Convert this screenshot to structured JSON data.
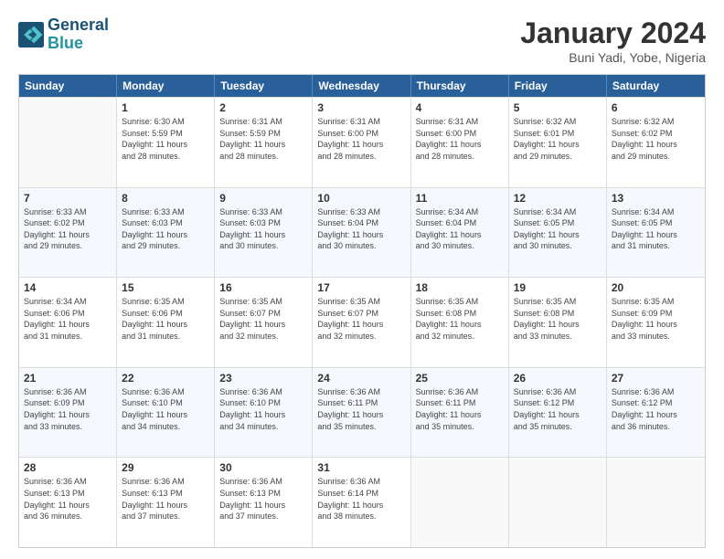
{
  "header": {
    "logo_line1": "General",
    "logo_line2": "Blue",
    "title": "January 2024",
    "subtitle": "Buni Yadi, Yobe, Nigeria"
  },
  "days_of_week": [
    "Sunday",
    "Monday",
    "Tuesday",
    "Wednesday",
    "Thursday",
    "Friday",
    "Saturday"
  ],
  "weeks": [
    [
      {
        "day": "",
        "info": ""
      },
      {
        "day": "1",
        "info": "Sunrise: 6:30 AM\nSunset: 5:59 PM\nDaylight: 11 hours\nand 28 minutes."
      },
      {
        "day": "2",
        "info": "Sunrise: 6:31 AM\nSunset: 5:59 PM\nDaylight: 11 hours\nand 28 minutes."
      },
      {
        "day": "3",
        "info": "Sunrise: 6:31 AM\nSunset: 6:00 PM\nDaylight: 11 hours\nand 28 minutes."
      },
      {
        "day": "4",
        "info": "Sunrise: 6:31 AM\nSunset: 6:00 PM\nDaylight: 11 hours\nand 28 minutes."
      },
      {
        "day": "5",
        "info": "Sunrise: 6:32 AM\nSunset: 6:01 PM\nDaylight: 11 hours\nand 29 minutes."
      },
      {
        "day": "6",
        "info": "Sunrise: 6:32 AM\nSunset: 6:02 PM\nDaylight: 11 hours\nand 29 minutes."
      }
    ],
    [
      {
        "day": "7",
        "info": "Sunrise: 6:33 AM\nSunset: 6:02 PM\nDaylight: 11 hours\nand 29 minutes."
      },
      {
        "day": "8",
        "info": "Sunrise: 6:33 AM\nSunset: 6:03 PM\nDaylight: 11 hours\nand 29 minutes."
      },
      {
        "day": "9",
        "info": "Sunrise: 6:33 AM\nSunset: 6:03 PM\nDaylight: 11 hours\nand 30 minutes."
      },
      {
        "day": "10",
        "info": "Sunrise: 6:33 AM\nSunset: 6:04 PM\nDaylight: 11 hours\nand 30 minutes."
      },
      {
        "day": "11",
        "info": "Sunrise: 6:34 AM\nSunset: 6:04 PM\nDaylight: 11 hours\nand 30 minutes."
      },
      {
        "day": "12",
        "info": "Sunrise: 6:34 AM\nSunset: 6:05 PM\nDaylight: 11 hours\nand 30 minutes."
      },
      {
        "day": "13",
        "info": "Sunrise: 6:34 AM\nSunset: 6:05 PM\nDaylight: 11 hours\nand 31 minutes."
      }
    ],
    [
      {
        "day": "14",
        "info": "Sunrise: 6:34 AM\nSunset: 6:06 PM\nDaylight: 11 hours\nand 31 minutes."
      },
      {
        "day": "15",
        "info": "Sunrise: 6:35 AM\nSunset: 6:06 PM\nDaylight: 11 hours\nand 31 minutes."
      },
      {
        "day": "16",
        "info": "Sunrise: 6:35 AM\nSunset: 6:07 PM\nDaylight: 11 hours\nand 32 minutes."
      },
      {
        "day": "17",
        "info": "Sunrise: 6:35 AM\nSunset: 6:07 PM\nDaylight: 11 hours\nand 32 minutes."
      },
      {
        "day": "18",
        "info": "Sunrise: 6:35 AM\nSunset: 6:08 PM\nDaylight: 11 hours\nand 32 minutes."
      },
      {
        "day": "19",
        "info": "Sunrise: 6:35 AM\nSunset: 6:08 PM\nDaylight: 11 hours\nand 33 minutes."
      },
      {
        "day": "20",
        "info": "Sunrise: 6:35 AM\nSunset: 6:09 PM\nDaylight: 11 hours\nand 33 minutes."
      }
    ],
    [
      {
        "day": "21",
        "info": "Sunrise: 6:36 AM\nSunset: 6:09 PM\nDaylight: 11 hours\nand 33 minutes."
      },
      {
        "day": "22",
        "info": "Sunrise: 6:36 AM\nSunset: 6:10 PM\nDaylight: 11 hours\nand 34 minutes."
      },
      {
        "day": "23",
        "info": "Sunrise: 6:36 AM\nSunset: 6:10 PM\nDaylight: 11 hours\nand 34 minutes."
      },
      {
        "day": "24",
        "info": "Sunrise: 6:36 AM\nSunset: 6:11 PM\nDaylight: 11 hours\nand 35 minutes."
      },
      {
        "day": "25",
        "info": "Sunrise: 6:36 AM\nSunset: 6:11 PM\nDaylight: 11 hours\nand 35 minutes."
      },
      {
        "day": "26",
        "info": "Sunrise: 6:36 AM\nSunset: 6:12 PM\nDaylight: 11 hours\nand 35 minutes."
      },
      {
        "day": "27",
        "info": "Sunrise: 6:36 AM\nSunset: 6:12 PM\nDaylight: 11 hours\nand 36 minutes."
      }
    ],
    [
      {
        "day": "28",
        "info": "Sunrise: 6:36 AM\nSunset: 6:13 PM\nDaylight: 11 hours\nand 36 minutes."
      },
      {
        "day": "29",
        "info": "Sunrise: 6:36 AM\nSunset: 6:13 PM\nDaylight: 11 hours\nand 37 minutes."
      },
      {
        "day": "30",
        "info": "Sunrise: 6:36 AM\nSunset: 6:13 PM\nDaylight: 11 hours\nand 37 minutes."
      },
      {
        "day": "31",
        "info": "Sunrise: 6:36 AM\nSunset: 6:14 PM\nDaylight: 11 hours\nand 38 minutes."
      },
      {
        "day": "",
        "info": ""
      },
      {
        "day": "",
        "info": ""
      },
      {
        "day": "",
        "info": ""
      }
    ]
  ]
}
